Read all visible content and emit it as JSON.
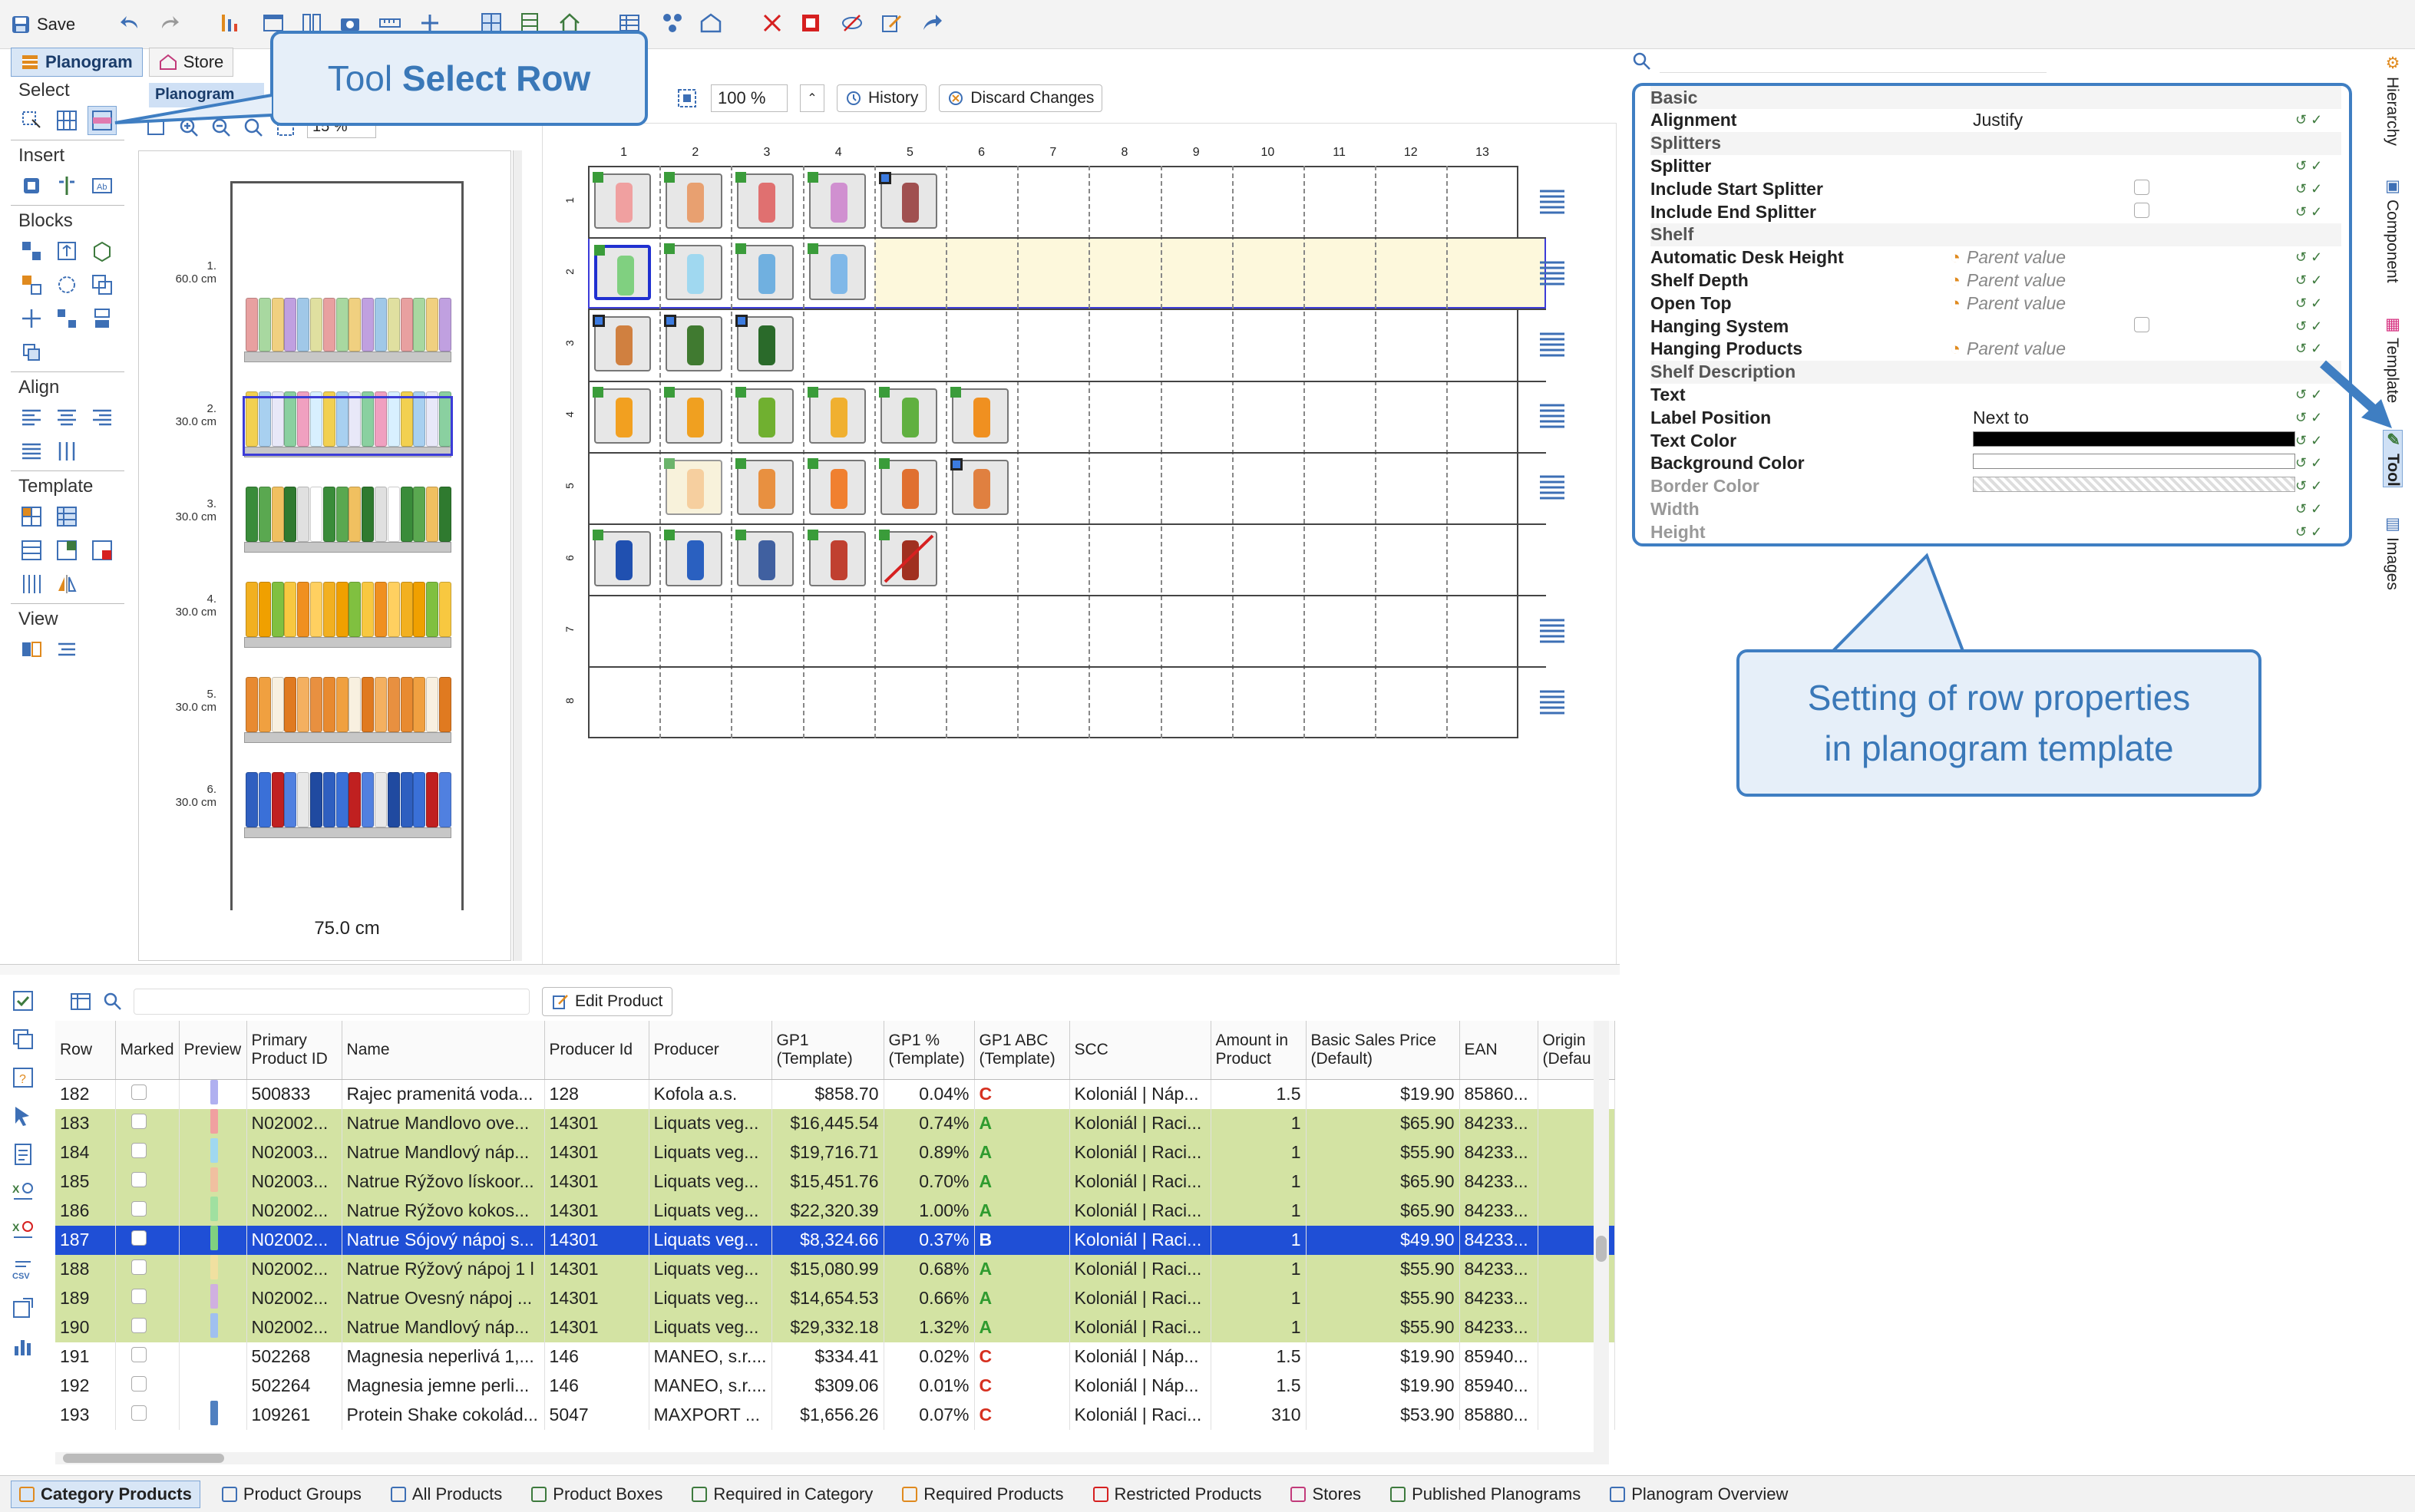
{
  "toolbar": {
    "save_label": "Save",
    "tabs": [
      "Planogram",
      "Store"
    ]
  },
  "palette": {
    "select": "Select",
    "insert": "Insert",
    "blocks": "Blocks",
    "align": "Align",
    "template": "Template",
    "view": "View"
  },
  "preview": {
    "tab_label": "Planogram",
    "zoom": "15 %",
    "width_label": "75.0 cm",
    "shelves": [
      {
        "num": "1.",
        "h": "60.0 cm"
      },
      {
        "num": "2.",
        "h": "30.0 cm"
      },
      {
        "num": "3.",
        "h": "30.0 cm"
      },
      {
        "num": "4.",
        "h": "30.0 cm"
      },
      {
        "num": "5.",
        "h": "30.0 cm"
      },
      {
        "num": "6.",
        "h": "30.0 cm"
      }
    ]
  },
  "editor": {
    "zoom": "100 %",
    "history_label": "History",
    "discard_label": "Discard Changes",
    "columns": [
      "1",
      "2",
      "3",
      "4",
      "5",
      "6",
      "7",
      "8",
      "9",
      "10",
      "11",
      "12",
      "13"
    ],
    "rows": [
      "1",
      "2",
      "3",
      "4",
      "5",
      "6",
      "7",
      "8"
    ]
  },
  "callouts": {
    "tool_select_row_prefix": "Tool ",
    "tool_select_row_bold": "Select Row",
    "setting_line1": "Setting of row properties",
    "setting_line2": "in planogram template"
  },
  "properties": {
    "rows": [
      {
        "label": "Basic",
        "group": true
      },
      {
        "label": "Alignment",
        "value": "Justify"
      },
      {
        "label": "Splitters",
        "group": true
      },
      {
        "label": "Splitter",
        "value": ""
      },
      {
        "label": "Include Start Splitter",
        "checkbox": true
      },
      {
        "label": "Include End Splitter",
        "checkbox": true
      },
      {
        "label": "Shelf",
        "group": true
      },
      {
        "label": "Automatic Desk Height",
        "parent": "Parent value"
      },
      {
        "label": "Shelf Depth",
        "parent": "Parent value"
      },
      {
        "label": "Open Top",
        "parent": "Parent value"
      },
      {
        "label": "Hanging System",
        "checkbox": true
      },
      {
        "label": "Hanging Products",
        "parent": "Parent value"
      },
      {
        "label": "Shelf Description",
        "group": true
      },
      {
        "label": "Text",
        "value": ""
      },
      {
        "label": "Label Position",
        "value": "Next to"
      },
      {
        "label": "Text Color",
        "color": "#000000"
      },
      {
        "label": "Background Color",
        "color": "#ffffff"
      },
      {
        "label": "Border Color",
        "disabled": true,
        "checker": true
      },
      {
        "label": "Width",
        "disabled": true
      },
      {
        "label": "Height",
        "disabled": true
      }
    ]
  },
  "side_tabs": [
    "Hierarchy",
    "Component",
    "Template",
    "Tool",
    "Images"
  ],
  "table": {
    "edit_product_label": "Edit Product",
    "headers": [
      "Row",
      "Marked",
      "Preview",
      "Primary Product ID",
      "Name",
      "Producer Id",
      "Producer",
      "GP1 (Template)",
      "GP1 % (Template)",
      "GP1 ABC (Template)",
      "SCC",
      "Amount in Product",
      "Basic Sales Price (Default)",
      "EAN",
      "Origin (Defau"
    ],
    "rows": [
      {
        "row": "182",
        "id": "500833",
        "name": "Rajec pramenitá voda...",
        "pid": "128",
        "producer": "Kofola a.s.",
        "gp1": "$858.70",
        "gp1p": "0.04%",
        "abc": "C",
        "scc": "Koloniál | Náp...",
        "amount": "1.5",
        "price": "$19.90",
        "ean": "85860...",
        "style": ""
      },
      {
        "row": "183",
        "id": "N02002...",
        "name": "Natrue Mandlovo ove...",
        "pid": "14301",
        "producer": "Liquats veg...",
        "gp1": "$16,445.54",
        "gp1p": "0.74%",
        "abc": "A",
        "scc": "Koloniál | Raci...",
        "amount": "1",
        "price": "$65.90",
        "ean": "84233...",
        "style": "green"
      },
      {
        "row": "184",
        "id": "N02003...",
        "name": "Natrue Mandlový náp...",
        "pid": "14301",
        "producer": "Liquats veg...",
        "gp1": "$19,716.71",
        "gp1p": "0.89%",
        "abc": "A",
        "scc": "Koloniál | Raci...",
        "amount": "1",
        "price": "$55.90",
        "ean": "84233...",
        "style": "green"
      },
      {
        "row": "185",
        "id": "N02003...",
        "name": "Natrue Rýžovo lískoor...",
        "pid": "14301",
        "producer": "Liquats veg...",
        "gp1": "$15,451.76",
        "gp1p": "0.70%",
        "abc": "A",
        "scc": "Koloniál | Raci...",
        "amount": "1",
        "price": "$65.90",
        "ean": "84233...",
        "style": "green"
      },
      {
        "row": "186",
        "id": "N02002...",
        "name": "Natrue Rýžovo kokos...",
        "pid": "14301",
        "producer": "Liquats veg...",
        "gp1": "$22,320.39",
        "gp1p": "1.00%",
        "abc": "A",
        "scc": "Koloniál | Raci...",
        "amount": "1",
        "price": "$65.90",
        "ean": "84233...",
        "style": "green"
      },
      {
        "row": "187",
        "id": "N02002...",
        "name": "Natrue Sójový nápoj s...",
        "pid": "14301",
        "producer": "Liquats veg...",
        "gp1": "$8,324.66",
        "gp1p": "0.37%",
        "abc": "B",
        "scc": "Koloniál | Raci...",
        "amount": "1",
        "price": "$49.90",
        "ean": "84233...",
        "style": "sel"
      },
      {
        "row": "188",
        "id": "N02002...",
        "name": "Natrue Rýžový nápoj 1 l",
        "pid": "14301",
        "producer": "Liquats veg...",
        "gp1": "$15,080.99",
        "gp1p": "0.68%",
        "abc": "A",
        "scc": "Koloniál | Raci...",
        "amount": "1",
        "price": "$55.90",
        "ean": "84233...",
        "style": "green"
      },
      {
        "row": "189",
        "id": "N02002...",
        "name": "Natrue Ovesný nápoj ...",
        "pid": "14301",
        "producer": "Liquats veg...",
        "gp1": "$14,654.53",
        "gp1p": "0.66%",
        "abc": "A",
        "scc": "Koloniál | Raci...",
        "amount": "1",
        "price": "$55.90",
        "ean": "84233...",
        "style": "green"
      },
      {
        "row": "190",
        "id": "N02002...",
        "name": "Natrue Mandlový náp...",
        "pid": "14301",
        "producer": "Liquats veg...",
        "gp1": "$29,332.18",
        "gp1p": "1.32%",
        "abc": "A",
        "scc": "Koloniál | Raci...",
        "amount": "1",
        "price": "$55.90",
        "ean": "84233...",
        "style": "green"
      },
      {
        "row": "191",
        "id": "502268",
        "name": "Magnesia neperlivá 1,...",
        "pid": "146",
        "producer": "MANEO, s.r....",
        "gp1": "$334.41",
        "gp1p": "0.02%",
        "abc": "C",
        "scc": "Koloniál | Náp...",
        "amount": "1.5",
        "price": "$19.90",
        "ean": "85940...",
        "style": ""
      },
      {
        "row": "192",
        "id": "502264",
        "name": "Magnesia jemne perli...",
        "pid": "146",
        "producer": "MANEO, s.r....",
        "gp1": "$309.06",
        "gp1p": "0.01%",
        "abc": "C",
        "scc": "Koloniál | Náp...",
        "amount": "1.5",
        "price": "$19.90",
        "ean": "85940...",
        "style": ""
      },
      {
        "row": "193",
        "id": "109261",
        "name": "Protein Shake cokolád...",
        "pid": "5047",
        "producer": "MAXPORT ...",
        "gp1": "$1,656.26",
        "gp1p": "0.07%",
        "abc": "C",
        "scc": "Koloniál | Raci...",
        "amount": "310",
        "price": "$53.90",
        "ean": "85880...",
        "style": ""
      }
    ]
  },
  "bottom_tabs": [
    "Category Products",
    "Product Groups",
    "All Products",
    "Product Boxes",
    "Required in Category",
    "Required Products",
    "Restricted Products",
    "Stores",
    "Published Planograms",
    "Planogram Overview"
  ],
  "colors": {
    "accent_blue": "#3f7ec2",
    "row_green": "#d3e3a3",
    "row_selected": "#1f4fd6",
    "abc_a": "#2f9b2f",
    "abc_b": "#1f4fd6",
    "abc_c": "#d63020"
  }
}
